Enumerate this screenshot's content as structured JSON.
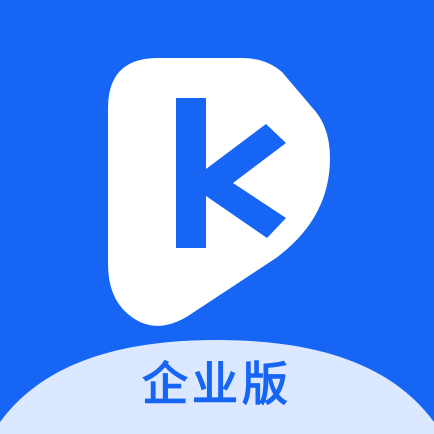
{
  "app_icon": {
    "logo_icon": "play-button-k-logo",
    "edition_label": "企业版",
    "colors": {
      "brand_blue": "#1765F5",
      "logo_white": "#FFFFFF",
      "banner_light_blue": "#DCE8FF"
    }
  }
}
